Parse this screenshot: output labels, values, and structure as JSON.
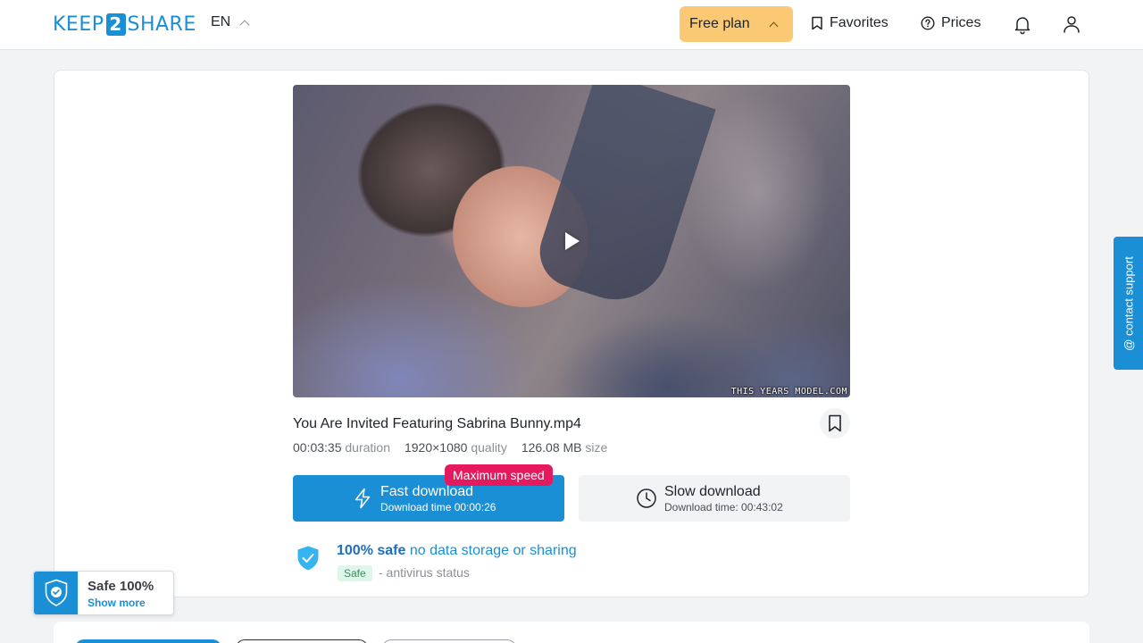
{
  "header": {
    "logo_left": "KEEP",
    "logo_mid": "2",
    "logo_right": "SHARE",
    "language": "EN",
    "plan_label": "Free plan",
    "favorites_label": "Favorites",
    "prices_label": "Prices"
  },
  "file": {
    "title": "You Are Invited Featuring Sabrina Bunny.mp4",
    "duration_value": "00:03:35",
    "duration_label": "duration",
    "quality_value": "1920×1080",
    "quality_label": "quality",
    "size_value": "126.08 MB",
    "size_label": "size",
    "video_watermark": "THIS YEARS MODEL.COM"
  },
  "download": {
    "fast_label": "Fast download",
    "fast_time": "Download time 00:00:26",
    "max_speed_badge": "Maximum speed",
    "slow_label": "Slow download",
    "slow_time": "Download time: 00:43:02"
  },
  "safety": {
    "headline_strong": "100% safe",
    "headline_rest": " no data storage or sharing",
    "tag": "Safe",
    "status": "- antivirus status"
  },
  "badge": {
    "title": "Safe 100%",
    "link": "Show more"
  },
  "support": {
    "label": "@ contact support"
  },
  "colors": {
    "brand_blue": "#1a8fd6",
    "plan_yellow": "#fbc974",
    "badge_red": "#e5195e",
    "safe_green": "#3a8c5a"
  },
  "icons": {
    "fast": "lightning-icon",
    "slow": "clock-icon",
    "favorites": "bookmark-icon",
    "prices": "question-circle-icon",
    "notifications": "bell-icon",
    "account": "user-icon",
    "safety": "shield-check-icon"
  }
}
